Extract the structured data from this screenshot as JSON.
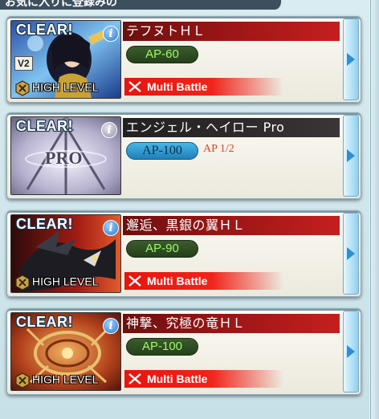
{
  "header": {
    "partial_text": "お気に入りに登録みの"
  },
  "colors": {
    "clear_text": "#ffffff",
    "ap_green": "#9dfa6a",
    "ap_blue_bg": "#2a95d0",
    "multi_red": "#ea170f",
    "title_red": "#951414",
    "title_dark": "#2f2b2c"
  },
  "quests": [
    {
      "clear": "CLEAR!",
      "info": "i",
      "badge": "V2",
      "level": "HIGH LEVEL",
      "title": "テフヌトＨＬ",
      "ap": "AP-60",
      "mode": "Multi Battle",
      "thumb_icon": "character-illustration-icon"
    },
    {
      "clear": "CLEAR!",
      "info": "i",
      "thumb_text": "PRO",
      "title": "エンジェル・ヘイロー Pro",
      "ap": "AP-100",
      "ap_note": "AP 1/2",
      "thumb_icon": "weapons-illustration-icon"
    },
    {
      "clear": "CLEAR!",
      "info": "i",
      "level": "HIGH LEVEL",
      "title": "邂逅、黒銀の翼ＨＬ",
      "ap": "AP-90",
      "mode": "Multi Battle",
      "thumb_icon": "black-dragon-illustration-icon"
    },
    {
      "clear": "CLEAR!",
      "info": "i",
      "level": "HIGH LEVEL",
      "title": "神撃、究極の竜ＨＬ",
      "ap": "AP-100",
      "mode": "Multi Battle",
      "thumb_icon": "golden-dragon-illustration-icon"
    }
  ]
}
